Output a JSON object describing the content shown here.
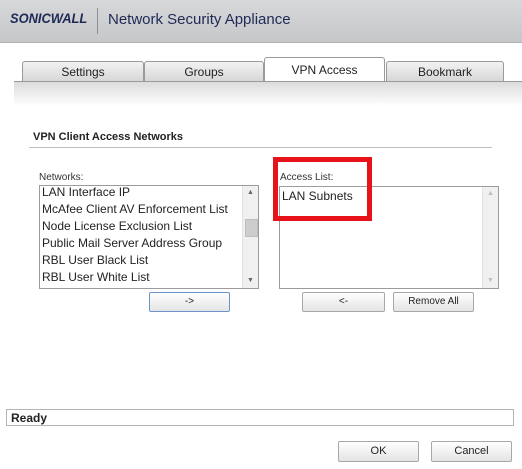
{
  "header": {
    "logo_text": "SONICWALL",
    "title": "Network Security Appliance"
  },
  "tabs": [
    {
      "label": "Settings",
      "active": false
    },
    {
      "label": "Groups",
      "active": false
    },
    {
      "label": "VPN Access",
      "active": true
    },
    {
      "label": "Bookmark",
      "active": false
    }
  ],
  "section": {
    "title": "VPN Client Access Networks"
  },
  "networks": {
    "label": "Networks:",
    "items": [
      "LAN Interface IP",
      "McAfee Client AV Enforcement List",
      "Node License Exclusion List",
      "Public Mail Server Address Group",
      "RBL User Black List",
      "RBL User White List"
    ],
    "add_button": "->"
  },
  "access_list": {
    "label": "Access List:",
    "items": [
      "LAN Subnets"
    ],
    "remove_button": "<-",
    "remove_all_button": "Remove All"
  },
  "status": {
    "text": "Ready"
  },
  "footer": {
    "ok_label": "OK",
    "cancel_label": "Cancel"
  },
  "colors": {
    "highlight": "#e8121a",
    "brand": "#1e2a56"
  }
}
